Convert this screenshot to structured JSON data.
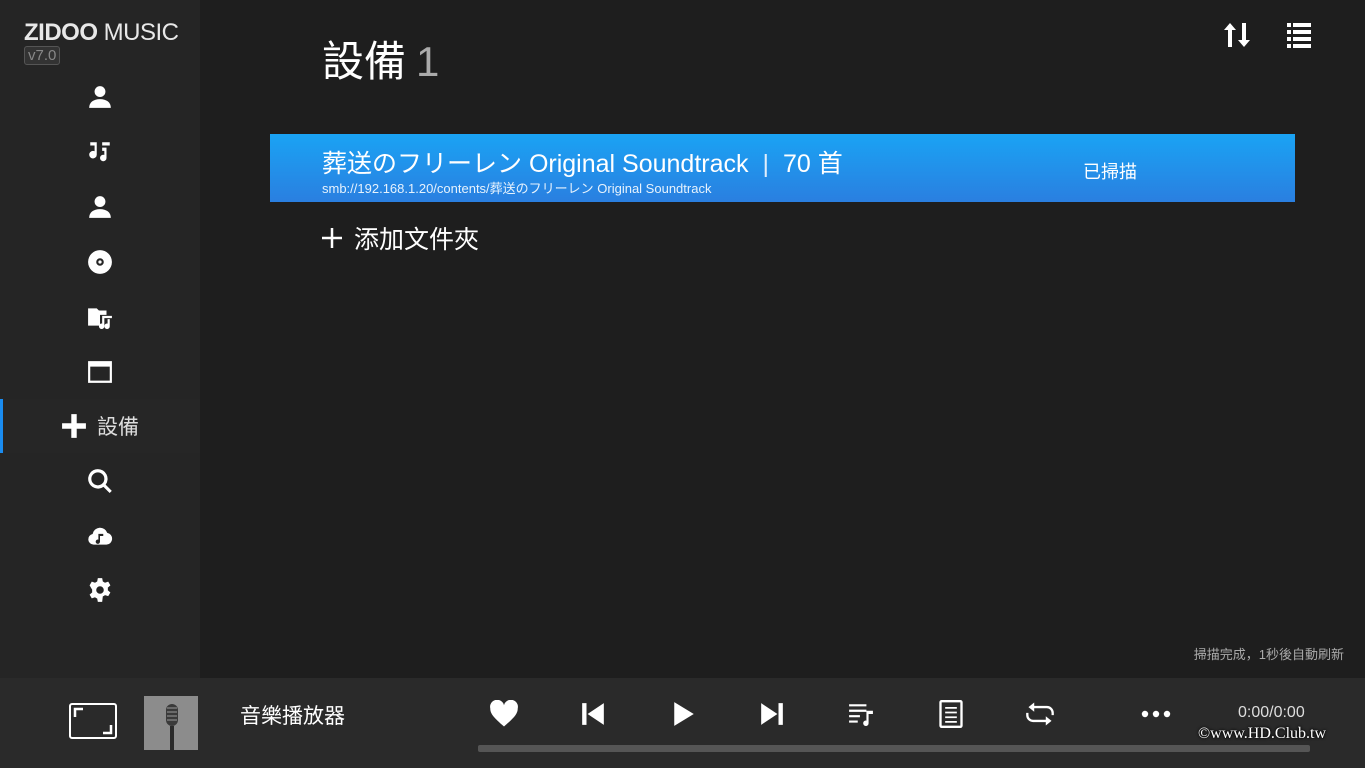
{
  "app": {
    "logo_main": "ZIDOO",
    "logo_sub": "MUSIC",
    "version": "v7.0"
  },
  "sidebar": {
    "items": [
      {
        "icon": "person-icon",
        "label": ""
      },
      {
        "icon": "music-note-icon",
        "label": ""
      },
      {
        "icon": "artist-icon",
        "label": ""
      },
      {
        "icon": "disc-icon",
        "label": ""
      },
      {
        "icon": "music-folder-icon",
        "label": ""
      },
      {
        "icon": "window-icon",
        "label": ""
      },
      {
        "icon": "plus-icon",
        "label": "設備"
      },
      {
        "icon": "search-icon",
        "label": ""
      },
      {
        "icon": "cloud-music-icon",
        "label": ""
      },
      {
        "icon": "gear-icon",
        "label": ""
      }
    ],
    "active_index": 6
  },
  "header": {
    "title": "設備",
    "count": "1"
  },
  "folders": [
    {
      "name": "葬送のフリーレン Original Soundtrack",
      "separator": "|",
      "track_count": "70 首",
      "path": "smb://192.168.1.20/contents/葬送のフリーレン Original Soundtrack",
      "status": "已掃描"
    }
  ],
  "add_folder_label": "添加文件夾",
  "scan_status": "掃描完成，1秒後自動刷新",
  "player": {
    "track_title": "音樂播放器",
    "time": "0:00/0:00",
    "progress": 0,
    "watermark": "©www.HD.Club.tw"
  },
  "colors": {
    "accent": "#1a8cf0",
    "row_gradient_top": "#1aa3f4",
    "row_gradient_bottom": "#2a7fe0",
    "background": "#1e1e1e",
    "sidebar": "#252525",
    "player_bar": "#2a2a2a"
  }
}
